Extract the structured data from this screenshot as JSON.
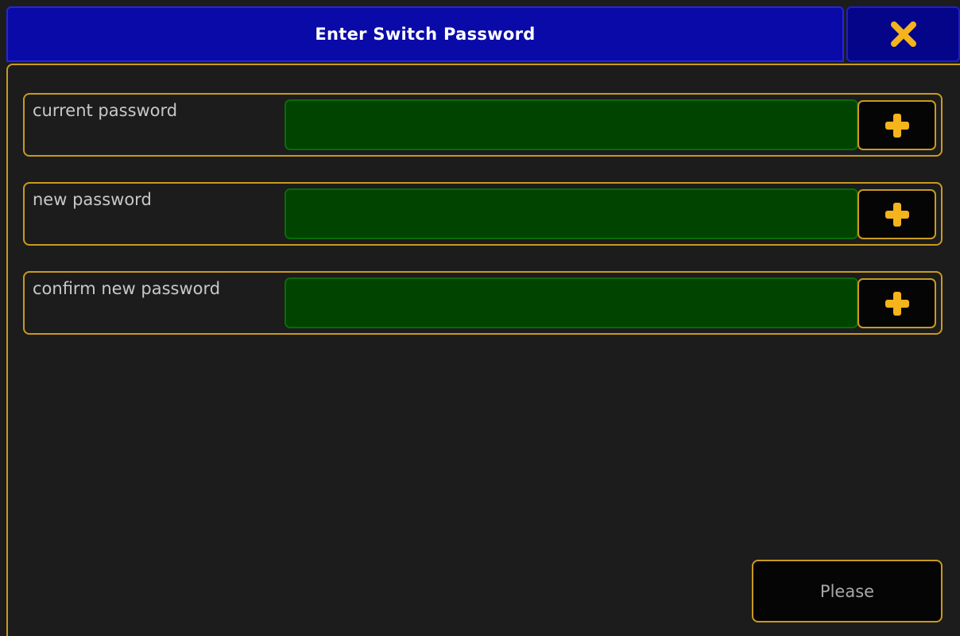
{
  "dialog": {
    "title": "Enter Switch Password",
    "close_icon": "close-icon"
  },
  "fields": [
    {
      "label": "current password",
      "value": "",
      "action_icon": "plus-icon"
    },
    {
      "label": "new password",
      "value": "",
      "action_icon": "plus-icon"
    },
    {
      "label": "confirm new password",
      "value": "",
      "action_icon": "plus-icon"
    }
  ],
  "footer": {
    "submit_label": "Please"
  },
  "colors": {
    "title_bar": "#0a0aa8",
    "accent_border": "#c99a1e",
    "input_background": "#004400",
    "icon_color": "#f5b31c",
    "background": "#1c1c1c"
  }
}
